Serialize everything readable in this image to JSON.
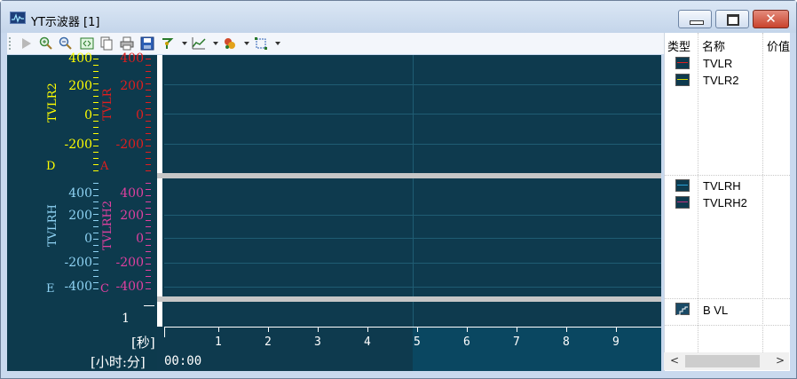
{
  "window": {
    "title": "YT示波器 [1]"
  },
  "toolbar": {
    "icons": [
      "play-icon",
      "zoom-in-icon",
      "zoom-out-icon",
      "fit-icon",
      "copy-icon",
      "print-icon",
      "save-icon",
      "cursor-icon",
      "chart-icon",
      "channels-icon",
      "select-icon"
    ]
  },
  "plot": {
    "pane1": {
      "left_axis": {
        "name": "TVLR2",
        "color": "#ffff00",
        "ticks": [
          "400",
          "200",
          "0",
          "-200"
        ],
        "letter": "D"
      },
      "right_axis": {
        "name": "TVLR",
        "color": "#e01e1e",
        "ticks": [
          "400",
          "200",
          "0",
          "-200"
        ],
        "letter": "A"
      }
    },
    "pane2": {
      "left_axis": {
        "name": "TVLRH",
        "color": "#8fd3f4",
        "ticks": [
          "400",
          "200",
          "0",
          "-200",
          "-400"
        ],
        "letter": "E"
      },
      "right_axis": {
        "name": "TVLRH2",
        "color": "#e040a0",
        "ticks": [
          "400",
          "200",
          "0",
          "-200",
          "-400"
        ],
        "letter": "C"
      }
    },
    "pane3": {
      "tick": "1"
    },
    "x_axis": {
      "unit_seconds": "[秒]",
      "unit_hm": "[小时:分]",
      "start_time": "00:00",
      "ticks": [
        "1",
        "2",
        "3",
        "4",
        "5",
        "6",
        "7",
        "8",
        "9"
      ]
    }
  },
  "legend": {
    "headers": {
      "type": "类型",
      "name": "名称",
      "value": "价值"
    },
    "groups": [
      {
        "items": [
          {
            "name": "TVLR",
            "color": "#e01e1e"
          },
          {
            "name": "TVLR2",
            "color": "#d8d800"
          }
        ]
      },
      {
        "items": [
          {
            "name": "TVLRH",
            "color": "#2a9fd6"
          },
          {
            "name": "TVLRH2",
            "color": "#c03080"
          }
        ]
      },
      {
        "items": [
          {
            "name": "B  VL",
            "color": "#ffffff"
          }
        ]
      }
    ]
  }
}
